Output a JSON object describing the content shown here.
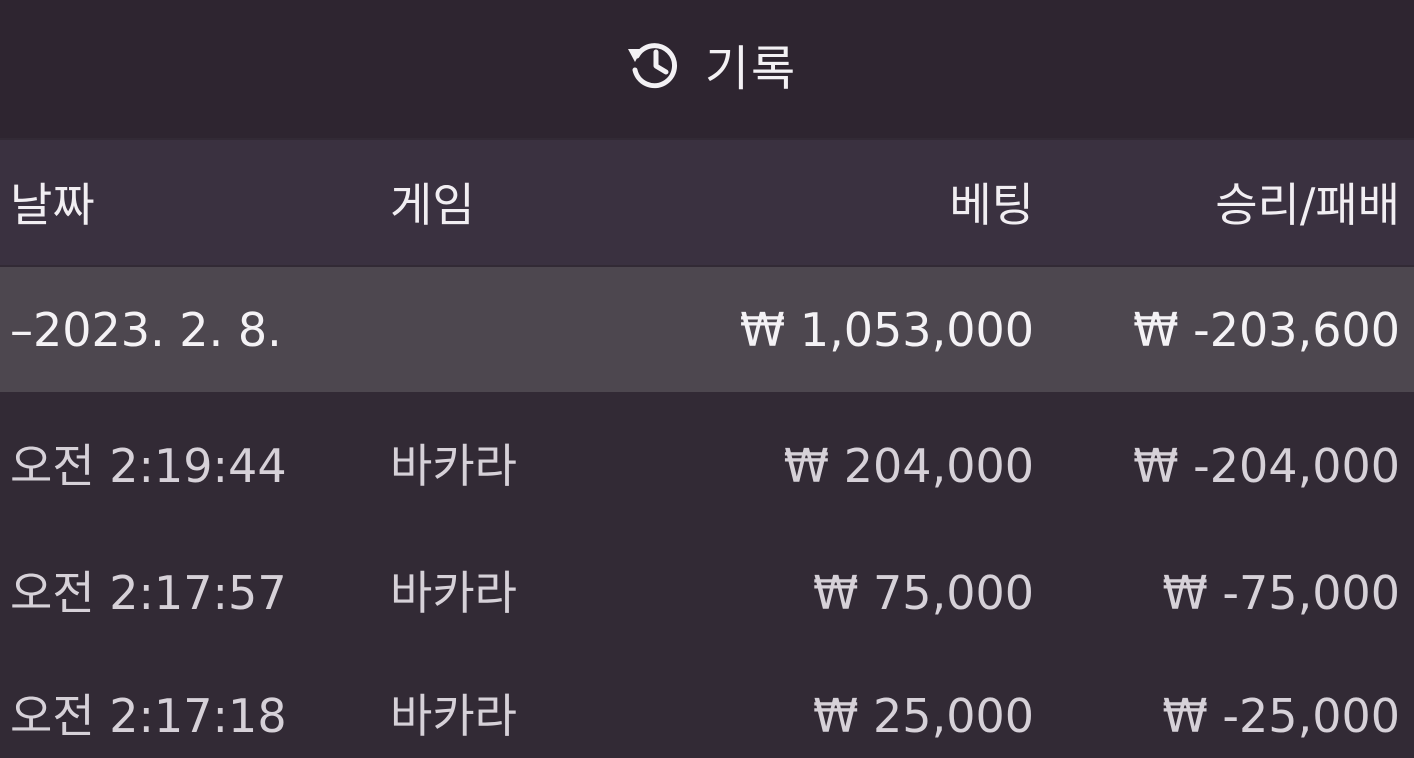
{
  "header": {
    "title": "기록",
    "icon": "history-icon"
  },
  "table": {
    "columns": {
      "date": "날짜",
      "game": "게임",
      "bet": "베팅",
      "result": "승리/패배"
    },
    "summary": {
      "date": "–2023. 2. 8.",
      "bet": "₩ 1,053,000",
      "result": "₩ -203,600"
    },
    "rows": [
      {
        "time": "오전 2:19:44",
        "game": "바카라",
        "bet": "₩ 204,000",
        "result": "₩ -204,000"
      },
      {
        "time": "오전 2:17:57",
        "game": "바카라",
        "bet": "₩ 75,000",
        "result": "₩ -75,000"
      },
      {
        "time": "오전 2:17:18",
        "game": "바카라",
        "bet": "₩ 25,000",
        "result": "₩ -25,000"
      }
    ]
  },
  "colors": {
    "background": "#322a35",
    "title_bar": "#2e2530",
    "header_row": "#3a3140",
    "summary_row": "#4d474f",
    "text": "#e7e3e8"
  }
}
